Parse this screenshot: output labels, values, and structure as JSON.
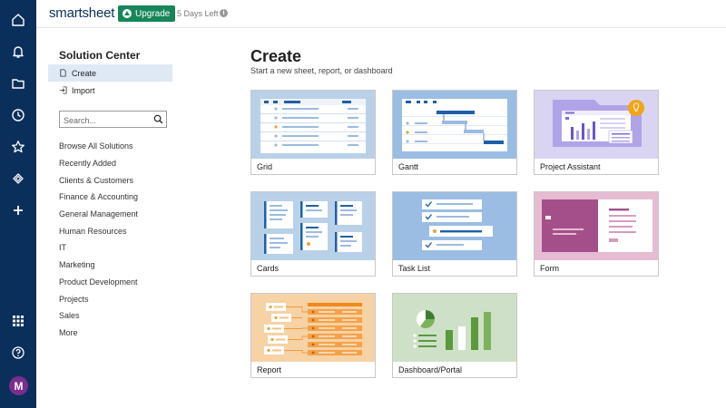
{
  "app": {
    "logo_text": "smartsheet",
    "upgrade_label": "Upgrade",
    "trial_text": "5 Days Left",
    "avatar_initial": "M"
  },
  "rail": {
    "icons": [
      "home-icon",
      "bell-icon",
      "folder-icon",
      "clock-icon",
      "star-icon",
      "solutions-icon",
      "plus-icon",
      "apps-grid-icon",
      "help-icon"
    ]
  },
  "sidebar": {
    "title": "Solution Center",
    "items": [
      {
        "label": "Create",
        "icon": "sheet-icon",
        "active": true
      },
      {
        "label": "Import",
        "icon": "import-icon",
        "active": false
      }
    ],
    "search_placeholder": "Search...",
    "categories": [
      "Browse All Solutions",
      "Recently Added",
      "Clients & Customers",
      "Finance & Accounting",
      "General Management",
      "Human Resources",
      "IT",
      "Marketing",
      "Product Development",
      "Projects",
      "Sales",
      "More"
    ]
  },
  "main": {
    "title": "Create",
    "subtitle": "Start a new sheet, report, or dashboard",
    "cards": [
      {
        "label": "Grid"
      },
      {
        "label": "Gantt"
      },
      {
        "label": "Project Assistant"
      },
      {
        "label": "Cards"
      },
      {
        "label": "Task List"
      },
      {
        "label": "Form"
      },
      {
        "label": "Report"
      },
      {
        "label": "Dashboard/Portal"
      }
    ]
  },
  "colors": {
    "rail": "#0b2f5b",
    "upgrade": "#16865a",
    "active_item": "#dfe9f6",
    "avatar": "#7b2c8f",
    "card_blue": "#b9d1e8",
    "card_purple": "#d9d4f2",
    "card_pink": "#e6bcd3",
    "card_orange": "#f6d2a4",
    "card_green": "#cfe0c8"
  }
}
